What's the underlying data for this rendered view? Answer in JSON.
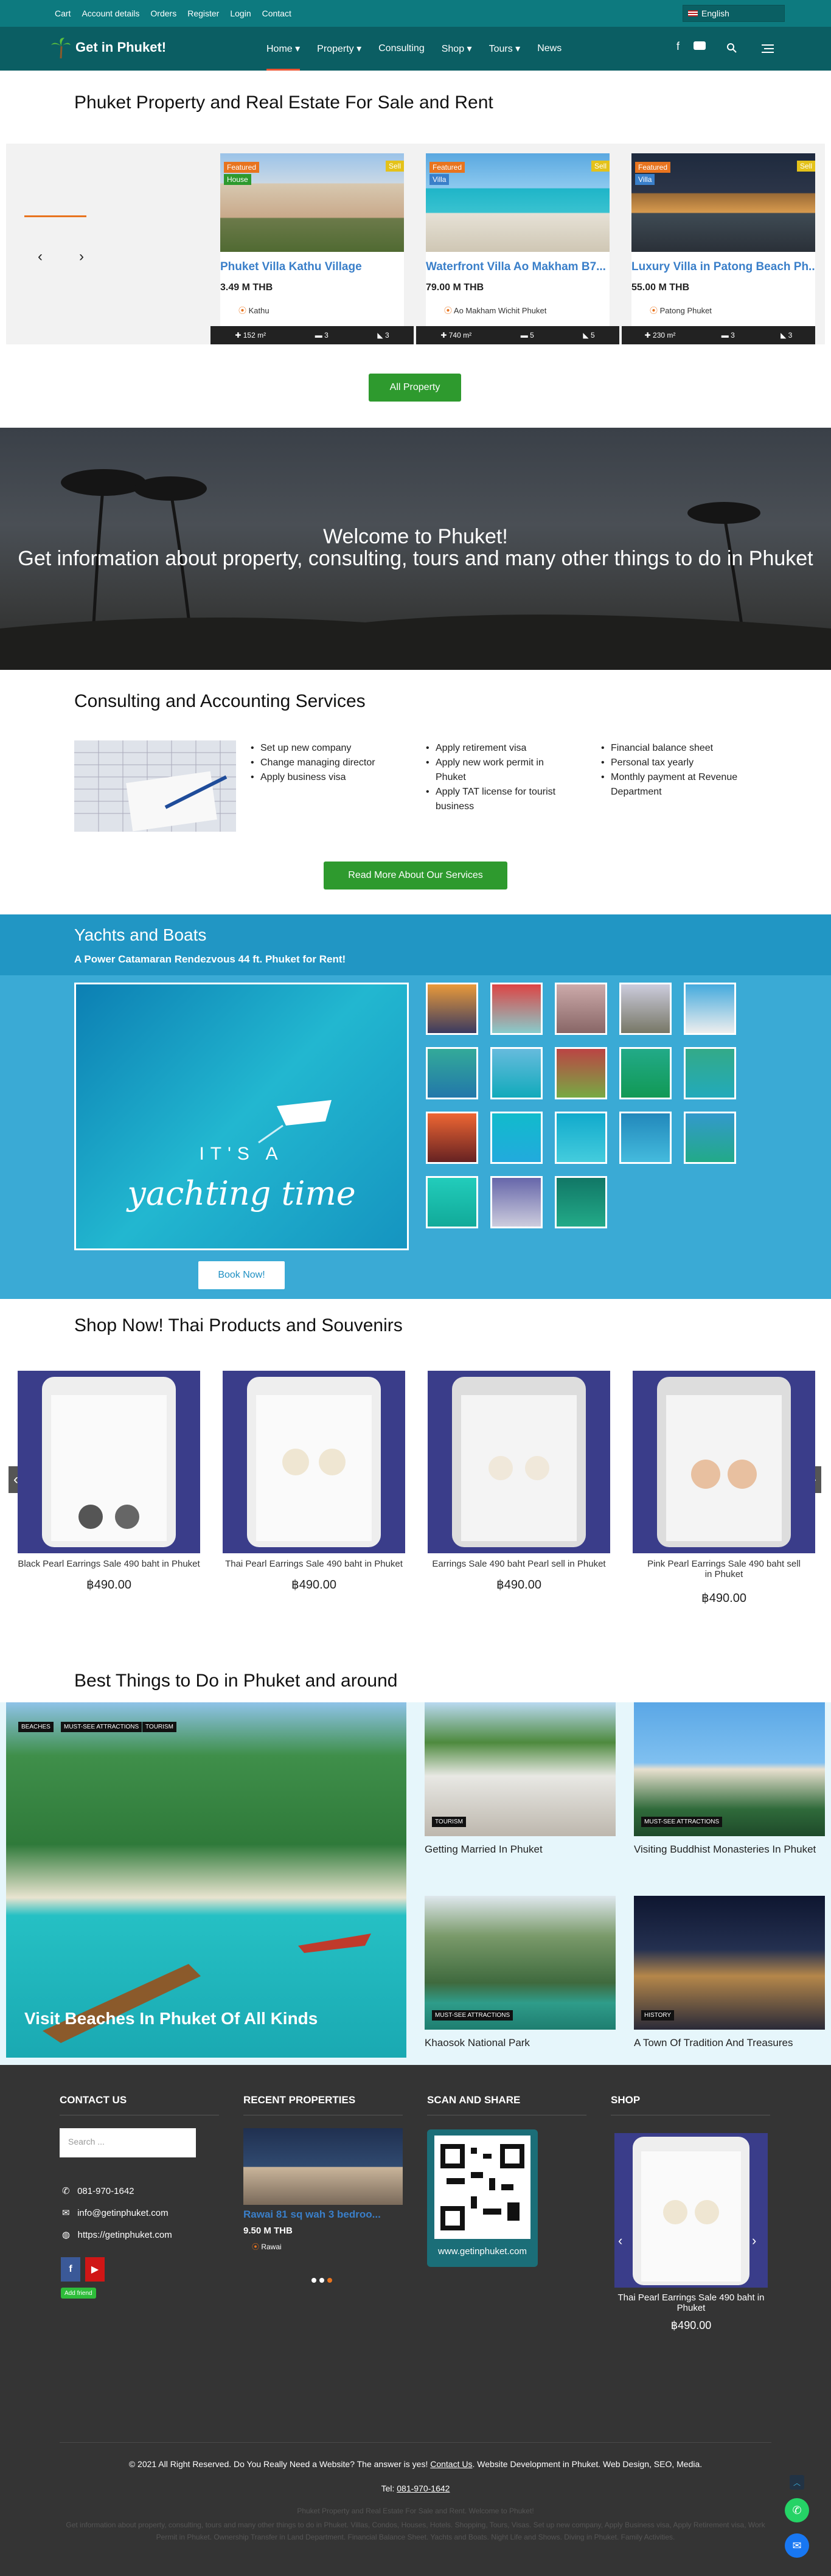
{
  "topbar": {
    "links": [
      "Cart",
      "Account details",
      "Orders",
      "Register",
      "Login",
      "Contact"
    ],
    "language": "English"
  },
  "nav": {
    "logo": "Get in Phuket!",
    "menu": [
      "Home",
      "Property",
      "Consulting",
      "Shop",
      "Tours",
      "News"
    ]
  },
  "properties": {
    "heading": "Phuket Property and Real Estate For Sale and Rent",
    "button": "All Property",
    "items": [
      {
        "featured": "Featured",
        "type": "House",
        "status": "Sell",
        "title": "Phuket Villa Kathu Village",
        "price": "3.49 M THB",
        "location": "Kathu",
        "area": "152 m²",
        "beds": "3",
        "baths": "3"
      },
      {
        "featured": "Featured",
        "type": "Villa",
        "status": "Sell",
        "title": "Waterfront Villa Ao Makham B7...",
        "price": "79.00 M THB",
        "location": "Ao Makham Wichit Phuket",
        "area": "740 m²",
        "beds": "5",
        "baths": "5"
      },
      {
        "featured": "Featured",
        "type": "Villa",
        "status": "Sell",
        "title": "Luxury Villa in Patong Beach Ph...",
        "price": "55.00 M THB",
        "location": "Patong Phuket",
        "area": "230 m²",
        "beds": "3",
        "baths": "3"
      }
    ]
  },
  "hero": {
    "line1": "Welcome to Phuket!",
    "line2": "Get information about property, consulting, tours and many other things to do in Phuket"
  },
  "consulting": {
    "heading": "Consulting and Accounting Services",
    "col1": [
      "Set up new company",
      "Change managing director",
      "Apply business visa"
    ],
    "col2": [
      "Apply retirement visa",
      "Apply new work permit in Phuket",
      "Apply TAT license for tourist business"
    ],
    "col3": [
      "Financial balance sheet",
      "Personal tax yearly",
      "Monthly payment at Revenue Department"
    ],
    "button": "Read More About Our Services"
  },
  "yachts": {
    "heading": "Yachts and Boats",
    "subheading": "A Power Catamaran Rendezvous 44 ft. Phuket for Rent!",
    "overlay1": "IT'S A",
    "overlay2": "yachting time",
    "button": "Book Now!"
  },
  "shop": {
    "heading": "Shop Now! Thai Products and Souvenirs",
    "items": [
      {
        "name": "Black Pearl Earrings Sale 490 baht in Phuket",
        "price": "฿490.00"
      },
      {
        "name": "Thai Pearl Earrings Sale 490 baht in Phuket",
        "price": "฿490.00"
      },
      {
        "name": "Earrings Sale 490 baht Pearl sell in Phuket",
        "price": "฿490.00"
      },
      {
        "name": "Pink Pearl Earrings Sale 490 baht sell in Phuket",
        "price": "฿490.00"
      }
    ]
  },
  "things": {
    "heading": "Best Things to Do in Phuket and around",
    "main": {
      "tags": [
        "BEACHES",
        "MUST-SEE ATTRACTIONS",
        "TOURISM"
      ],
      "title": "Visit Beaches In Phuket Of All Kinds"
    },
    "items": [
      {
        "tag": "TOURISM",
        "title": "Getting Married In Phuket"
      },
      {
        "tag": "MUST-SEE ATTRACTIONS",
        "title": "Visiting Buddhist Monasteries In Phuket"
      },
      {
        "tag": "MUST-SEE ATTRACTIONS",
        "title": "Khaosok National Park"
      },
      {
        "tag": "HISTORY",
        "title": "A Town Of Tradition And Treasures"
      }
    ]
  },
  "footer": {
    "contact_head": "CONTACT US",
    "search_placeholder": "Search ...",
    "phone": "081-970-1642",
    "email": "info@getinphuket.com",
    "site": "https://getinphuket.com",
    "addfriend": "Add friend",
    "recent_head": "RECENT PROPERTIES",
    "recent_title": "Rawai 81 sq wah 3 bedroo...",
    "recent_price": "9.50 M THB",
    "recent_loc": "Rawai",
    "scan_head": "SCAN AND SHARE",
    "scan_url": "www.getinphuket.com",
    "shop_head": "SHOP",
    "shop_name": "Thai Pearl Earrings Sale 490 baht in Phuket",
    "shop_price": "฿490.00",
    "copyright_pre": "© 2021 All Right Reserved. Do You Really Need a Website? The answer is yes!",
    "copyright_link": "Contact Us",
    "copyright_post": ". Website Development in Phuket. Web Design, SEO, Media.",
    "tel_label": "Tel:",
    "tel": "081-970-1642",
    "desc1": "Phuket Property and Real Estate For Sale and Rent. Welcome to Phuket!",
    "desc2": "Get information about property, consulting, tours and many other things to do in Phuket. Villas, Condos, Houses, Hotels. Shopping, Tours, Visas. Set up new company, Apply Business visa, Apply Retirement visa, Work Permit in Phuket. Ownership Transfer in Land Department. Financial Balance Sheet. Yachts and Boats. Night Life and Shows. Diving in Phuket. Family Activities."
  },
  "colors": {
    "teal": "#0d7a7f",
    "nav": "#0b5e63",
    "accent": "#e8741f",
    "green": "#2e9a2e",
    "yacht": "#3aaad5",
    "title_blue": "#3a7fc9"
  }
}
